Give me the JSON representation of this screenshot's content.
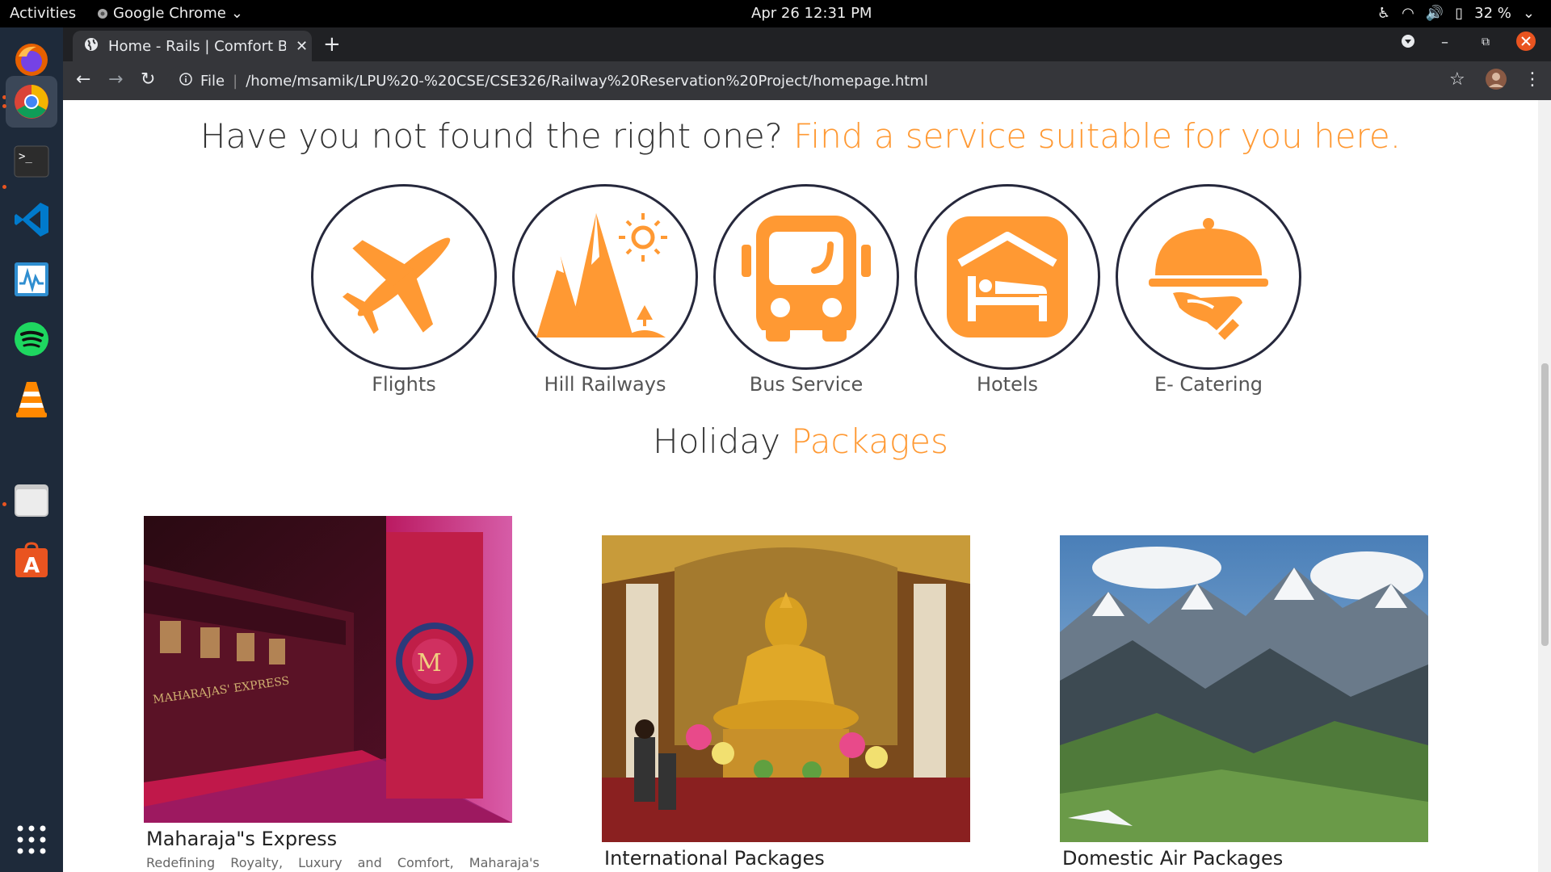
{
  "topbar": {
    "activities": "Activities",
    "app_name": "Google Chrome",
    "clock": "Apr 26  12:31 PM",
    "battery": "32 %"
  },
  "dock": {
    "items": [
      "firefox-icon",
      "chrome-icon",
      "terminal-icon",
      "vscode-icon",
      "system-monitor-icon",
      "spotify-icon",
      "vlc-icon",
      "files-icon",
      "software-center-icon"
    ]
  },
  "browser": {
    "tab_title": "Home - Rails | Comfort Be",
    "scheme": "File",
    "url": "/home/msamik/LPU%20-%20CSE/CSE326/Railway%20Reservation%20Project/homepage.html"
  },
  "page": {
    "services_heading": {
      "plain": "Have you not found the right one? ",
      "highlight": "Find a service suitable for you here."
    },
    "services": [
      {
        "label": "Flights",
        "icon": "airplane-icon"
      },
      {
        "label": "Hill Railways",
        "icon": "mountain-icon"
      },
      {
        "label": "Bus Service",
        "icon": "bus-icon"
      },
      {
        "label": "Hotels",
        "icon": "hotel-bed-icon"
      },
      {
        "label": "E- Catering",
        "icon": "cloche-icon"
      }
    ],
    "packages_heading": {
      "plain": "Holiday ",
      "highlight": "Packages"
    },
    "packages": [
      {
        "title": "Maharaja\"s Express",
        "desc": "Redefining Royalty, Luxury and Comfort, Maharaja's"
      },
      {
        "title": "International Packages"
      },
      {
        "title": "Domestic Air Packages"
      }
    ],
    "accent_color": "#ff9933"
  }
}
